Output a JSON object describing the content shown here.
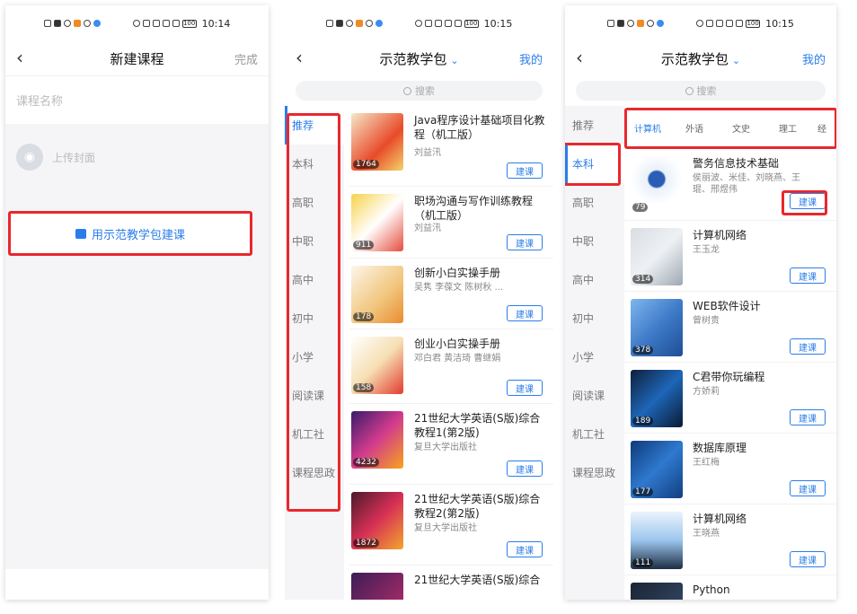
{
  "status": {
    "left_time_1": "10:14",
    "left_time_2": "10:15",
    "left_time_3": "10:15",
    "battery": "100"
  },
  "panel1": {
    "title": "新建课程",
    "done": "完成",
    "name_placeholder": "课程名称",
    "upload_cover": "上传封面",
    "demo_button": "用示范教学包建课"
  },
  "panel2": {
    "title": "示范教学包",
    "mine": "我的",
    "search": "搜索",
    "categories": [
      "推荐",
      "本科",
      "高职",
      "中职",
      "高中",
      "初中",
      "小学",
      "阅读课",
      "机工社",
      "课程思政"
    ],
    "books": [
      {
        "title": "Java程序设计基础项目化教程（机工版）",
        "author": "刘益汛",
        "count": "1764",
        "btn": "建课"
      },
      {
        "title": "职场沟通与写作训练教程（机工版）",
        "author": "刘益汛",
        "count": "911",
        "btn": "建课"
      },
      {
        "title": "创新小白实操手册",
        "author": "吴隽 李葆文 陈树秋 ...",
        "count": "178",
        "btn": "建课"
      },
      {
        "title": "创业小白实操手册",
        "author": "邓白君 黄洁琦 曹继娟",
        "count": "158",
        "btn": "建课"
      },
      {
        "title": "21世纪大学英语(S版)综合教程1(第2版)",
        "author": "复旦大学出版社",
        "count": "4232",
        "btn": "建课"
      },
      {
        "title": "21世纪大学英语(S版)综合教程2(第2版)",
        "author": "复旦大学出版社",
        "count": "1872",
        "btn": "建课"
      },
      {
        "title": "21世纪大学英语(S版)综合",
        "author": "",
        "count": "",
        "btn": ""
      }
    ]
  },
  "panel3": {
    "title": "示范教学包",
    "mine": "我的",
    "search": "搜索",
    "categories": [
      "推荐",
      "本科",
      "高职",
      "中职",
      "高中",
      "初中",
      "小学",
      "阅读课",
      "机工社",
      "课程思政"
    ],
    "tabs": [
      "计算机",
      "外语",
      "文史",
      "理工",
      "经"
    ],
    "books": [
      {
        "title": "警务信息技术基础",
        "author": "侯丽波、米佳、刘晓燕、王琨、邢煜伟",
        "count": "79",
        "btn": "建课"
      },
      {
        "title": "计算机网络",
        "author": "王玉龙",
        "count": "314",
        "btn": "建课"
      },
      {
        "title": "WEB软件设计",
        "author": "曾树贵",
        "count": "378",
        "btn": "建课"
      },
      {
        "title": "C君带你玩编程",
        "author": "方娇莉",
        "count": "189",
        "btn": "建课"
      },
      {
        "title": "数据库原理",
        "author": "王红梅",
        "count": "177",
        "btn": "建课"
      },
      {
        "title": "计算机网络",
        "author": "王晓燕",
        "count": "111",
        "btn": "建课"
      },
      {
        "title": "Python",
        "author": "",
        "count": "",
        "btn": ""
      }
    ]
  },
  "colors": {
    "accent": "#2b7de9",
    "highlight": "#e8282d"
  }
}
